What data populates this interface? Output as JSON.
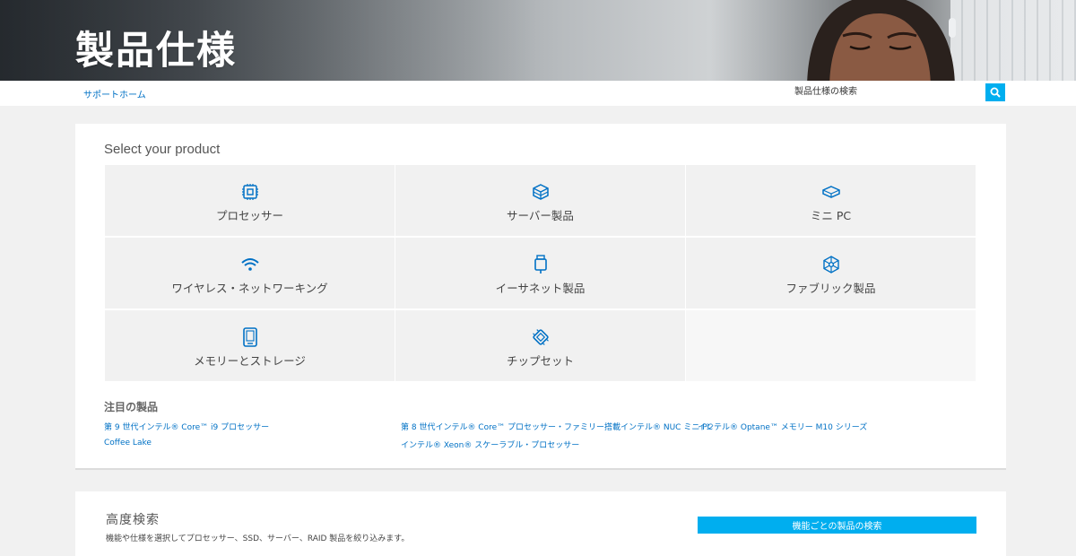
{
  "hero": {
    "title": "製品仕様"
  },
  "topbar": {
    "support_link": "サポートホーム",
    "search_label": "製品仕様の検索"
  },
  "products": {
    "heading": "Select your product",
    "tiles": [
      {
        "label": "プロセッサー",
        "icon": "processor-icon"
      },
      {
        "label": "サーバー製品",
        "icon": "server-icon"
      },
      {
        "label": "ミニ PC",
        "icon": "mini-pc-icon"
      },
      {
        "label": "ワイヤレス・ネットワーキング",
        "icon": "wifi-icon"
      },
      {
        "label": "イーサネット製品",
        "icon": "ethernet-icon"
      },
      {
        "label": "ファブリック製品",
        "icon": "fabric-icon"
      },
      {
        "label": "メモリーとストレージ",
        "icon": "storage-icon"
      },
      {
        "label": "チップセット",
        "icon": "chipset-icon"
      }
    ]
  },
  "featured": {
    "heading": "注目の製品",
    "links": [
      "第 9 世代インテル® Core™ i9 プロセッサー",
      "第 8 世代インテル® Core™ プロセッサー・ファミリー搭載インテル® NUC ミニ PC",
      "インテル® Optane™ メモリー M10 シリーズ",
      "Coffee Lake",
      "インテル® Xeon® スケーラブル・プロセッサー"
    ]
  },
  "advanced": {
    "heading": "高度検索",
    "description": "機能や仕様を選択してプロセッサー、SSD、サーバー、RAID 製品を絞り込みます。",
    "button": "機能ごとの製品の検索"
  },
  "colors": {
    "accent": "#00aeef",
    "link": "#0071c5",
    "icon": "#0071c5"
  }
}
